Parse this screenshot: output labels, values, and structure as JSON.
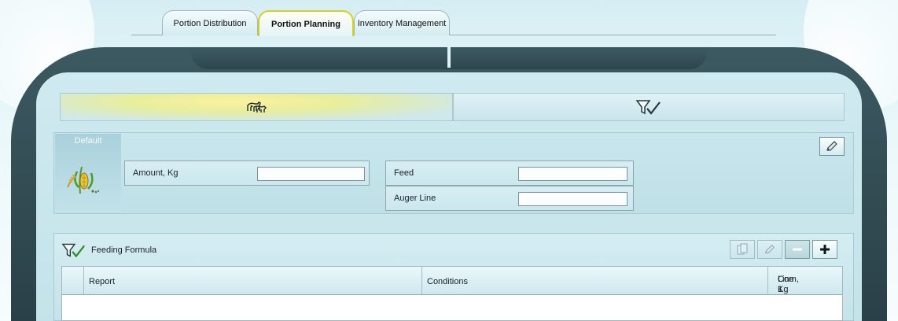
{
  "tabs": {
    "distribution": "Portion Distribution",
    "planning": "Portion Planning",
    "inventory": "Inventory Management"
  },
  "subtabs": {
    "cows_icon": "cows-icon",
    "formula_icon": "feeding-formula-icon"
  },
  "default_section": {
    "title": "Default",
    "icon": "grain-feed-icon",
    "amount_label": "Amount, Kg",
    "amount_value": "",
    "feed_label": "Feed",
    "feed_value": "",
    "auger_label": "Auger Line",
    "auger_value": "",
    "edit_icon": "pencil-icon"
  },
  "feeding_formula": {
    "title": "Feeding Formula",
    "icon": "feeding-formula-icon",
    "toolbar": [
      "copy-icon",
      "pencil-icon",
      "minus-icon",
      "plus-icon"
    ],
    "columns": {
      "report": "Report",
      "conditions": "Conditions",
      "line1_top": "Line 1",
      "line1_bottom": "Corn, Kg"
    },
    "rows": []
  },
  "colors": {
    "active_tab_border": "#d6cf22",
    "dark_band": "#2e474f",
    "panel": "#c5e3ea"
  }
}
